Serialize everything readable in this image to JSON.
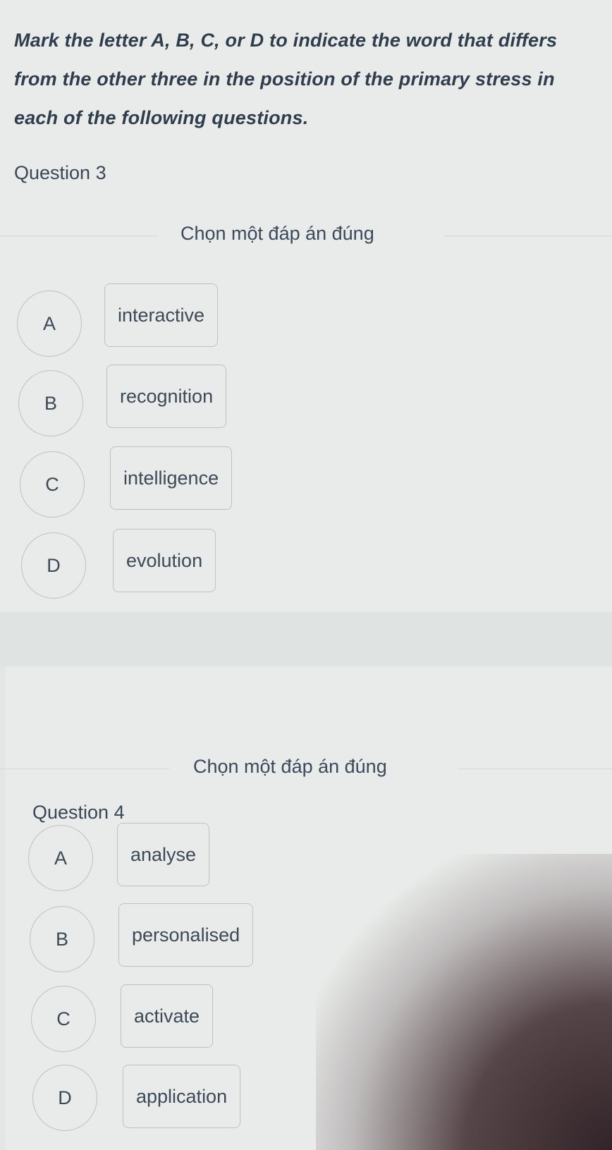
{
  "instructions": "Mark the letter A, B, C, or D to indicate the word that differs from the other three in the position of the primary stress in each of the following questions.",
  "questions": [
    {
      "title": "Question 3",
      "prompt": "Chọn một đáp án đúng",
      "options": [
        {
          "letter": "A",
          "text": "interactive"
        },
        {
          "letter": "B",
          "text": "recognition"
        },
        {
          "letter": "C",
          "text": "intelligence"
        },
        {
          "letter": "D",
          "text": "evolution"
        }
      ]
    },
    {
      "title": "Question 4",
      "prompt": "Chọn một đáp án đúng",
      "options": [
        {
          "letter": "A",
          "text": "analyse"
        },
        {
          "letter": "B",
          "text": "personalised"
        },
        {
          "letter": "C",
          "text": "activate"
        },
        {
          "letter": "D",
          "text": "application"
        }
      ]
    }
  ]
}
